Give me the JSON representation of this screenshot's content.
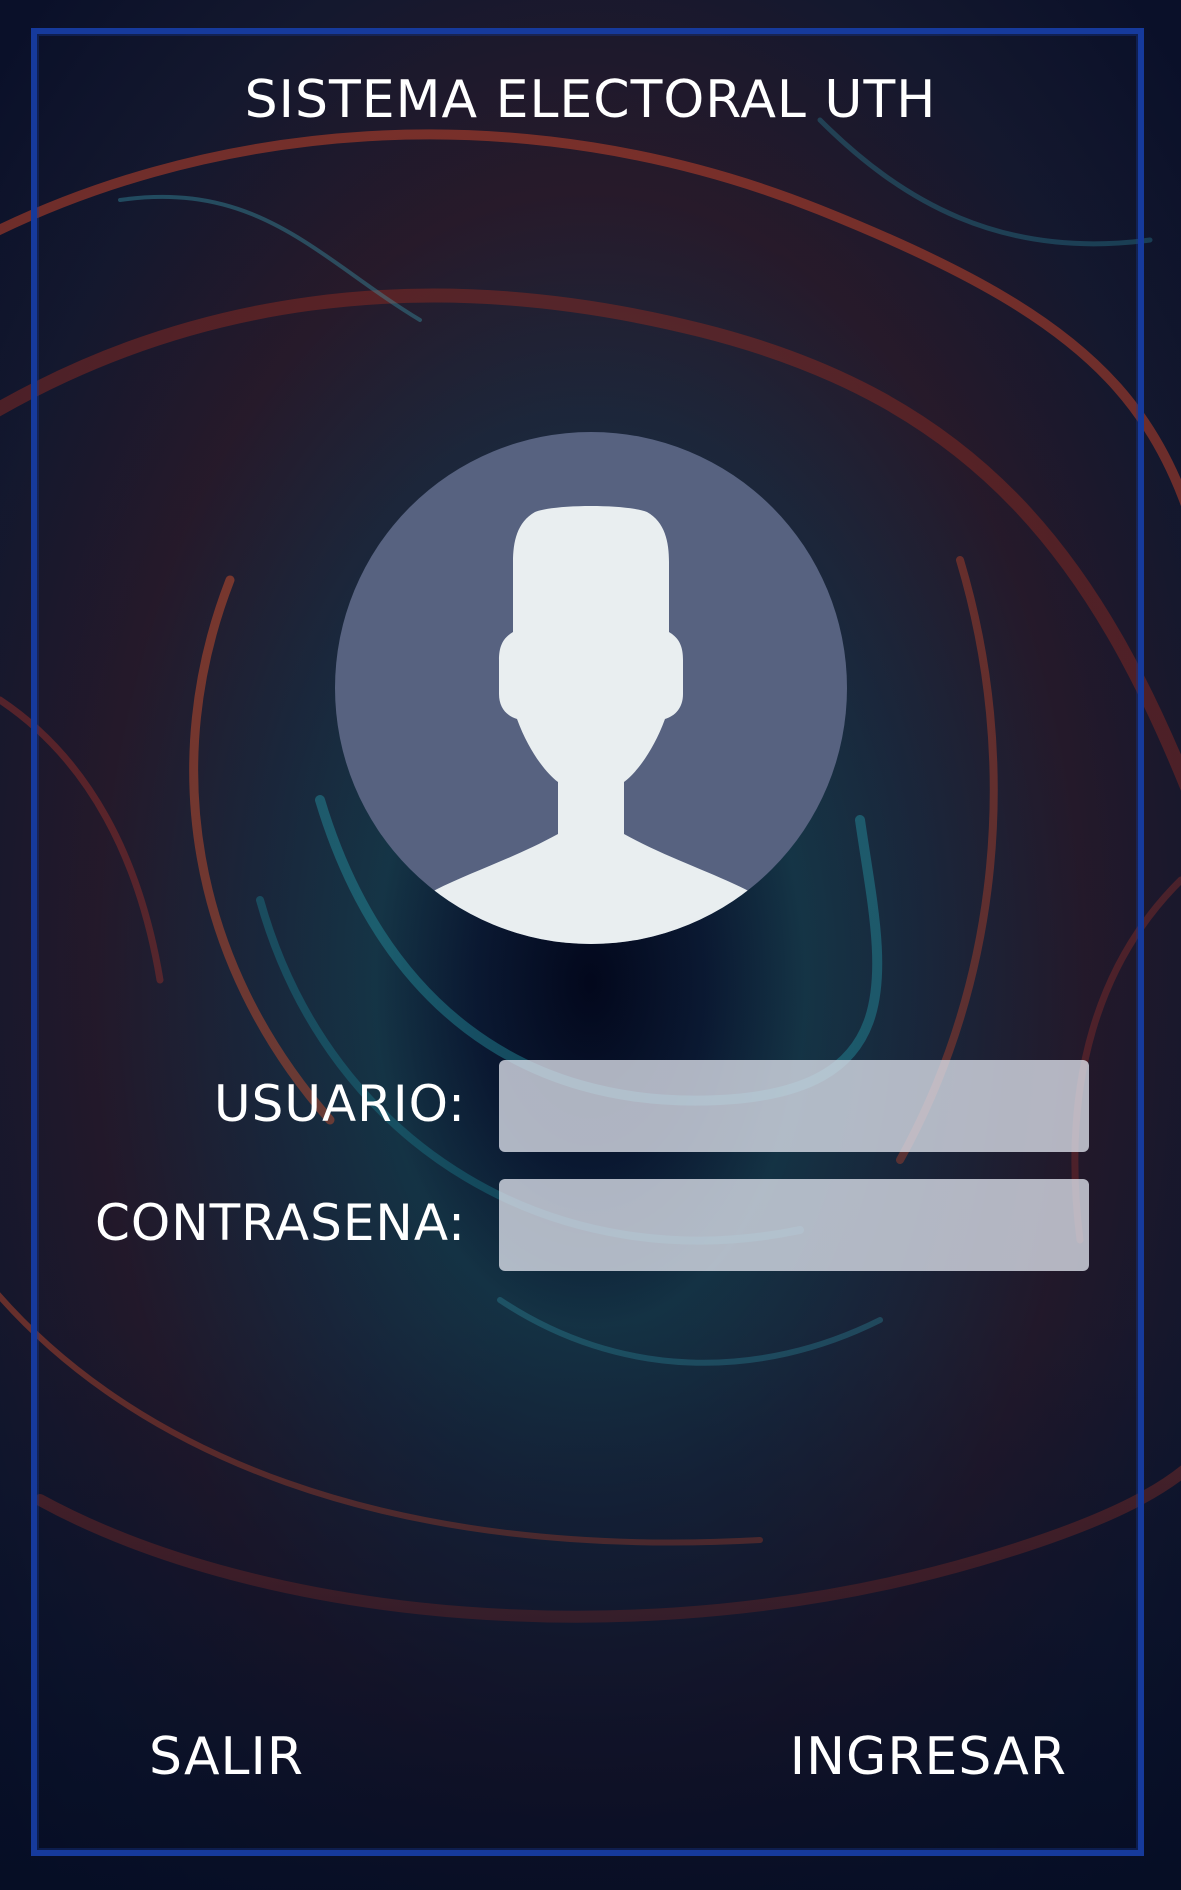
{
  "app": {
    "title": "SISTEMA ELECTORAL UTH"
  },
  "login_form": {
    "username_label": "USUARIO:",
    "username_value": "",
    "password_label": "CONTRASENA:",
    "password_value": ""
  },
  "actions": {
    "exit_label": "SALIR",
    "login_label": "INGRESAR"
  },
  "icons": {
    "avatar": "default-user-silhouette-icon"
  },
  "colors": {
    "background": "#07112a",
    "frame_border": "#163a9c",
    "avatar_circle": "#576280",
    "avatar_figure": "#e9eef0",
    "input_fill": "#dee2ec",
    "text": "#ffffff"
  }
}
